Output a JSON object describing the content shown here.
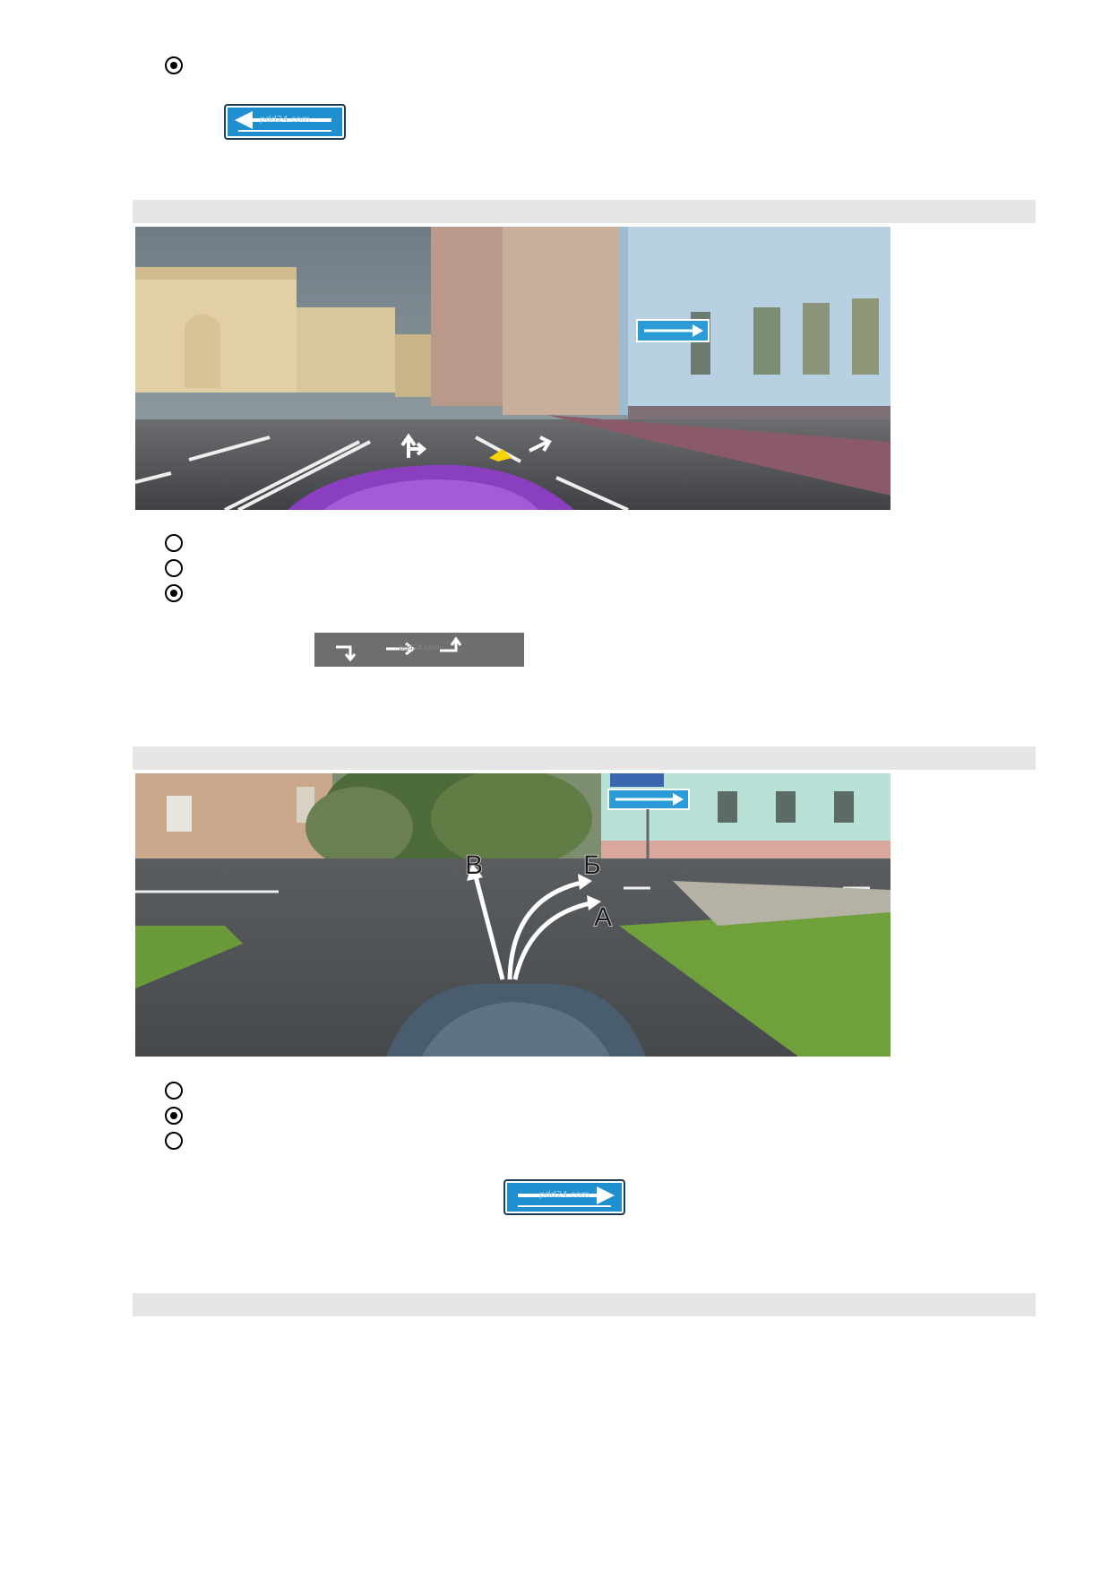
{
  "question_1": {
    "answer_selected": true,
    "sign": {
      "icon": "left-arrow-direction-sign",
      "watermark": "pdd24.com",
      "color": "#1f8fd0"
    }
  },
  "question_2": {
    "options": [
      {
        "selected": false
      },
      {
        "selected": false
      },
      {
        "selected": true
      }
    ],
    "photo": {
      "icon": "city-street-with-lane-arrows-photo",
      "sign_icon": "right-arrow-direction-sign"
    },
    "explanation_sign": {
      "icon": "lane-direction-arrows-sign",
      "watermark": "pdd24.com",
      "color": "#6e6e6e"
    }
  },
  "question_3": {
    "options": [
      {
        "selected": false
      },
      {
        "selected": true
      },
      {
        "selected": false
      }
    ],
    "photo": {
      "icon": "intersection-with-route-arrows-photo",
      "labels": {
        "a": "А",
        "b": "Б",
        "v": "В"
      }
    },
    "explanation_sign": {
      "icon": "right-arrow-direction-sign",
      "watermark": "pdd24.com",
      "color": "#1f8fd0"
    }
  }
}
